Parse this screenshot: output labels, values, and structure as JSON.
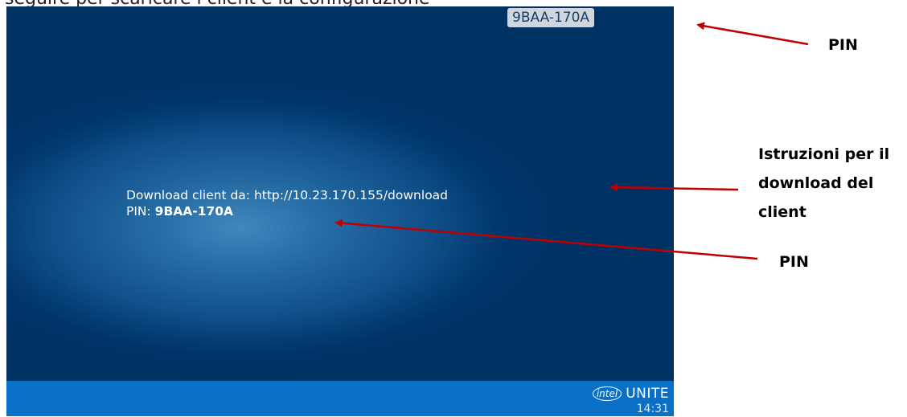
{
  "caption_above": "seguire per scaricare i client e la configurazione",
  "screen": {
    "pin_badge": "9BAA-170A",
    "download_line": "Download client da: http://10.23.170.155/download",
    "pin_label": "PIN: ",
    "pin_value": "9BAA-170A",
    "brand_logo": "intel",
    "brand_product": "UNITE",
    "clock": "14:31"
  },
  "annotations": {
    "pin_top": "PIN",
    "client_instructions_line1": "Istruzioni per il",
    "client_instructions_line2": "download del",
    "client_instructions_line3": "client",
    "pin_bottom": "PIN"
  },
  "colors": {
    "screen_bg": "#003b73",
    "footer_bar": "#0a6fc7",
    "arrow": "#c00000"
  }
}
